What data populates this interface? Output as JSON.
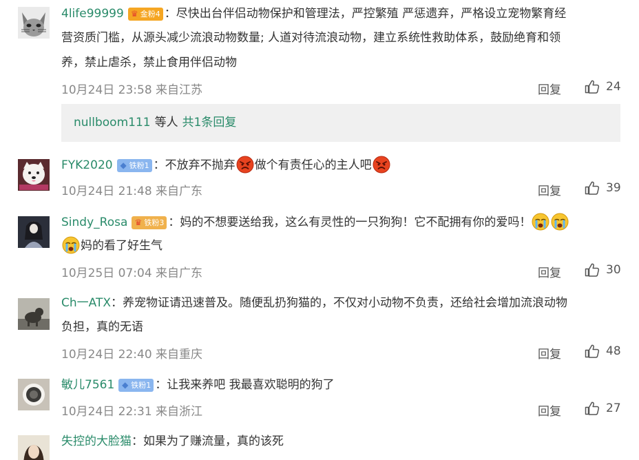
{
  "comments": [
    {
      "username": "4life99999",
      "badge": "金粉4",
      "text1": "：尽快出台伴侣动物保护和管理法，严控繁殖 严惩遗弃，严格设立宠物繁育经",
      "text2": "营资质门槛，从源头减少流浪动物数量; 人道对待流浪动物，建立系统性救助体系，鼓励绝育和领",
      "text3": "养，禁止虐杀，禁止食用伴侣动物",
      "time": "10月24日 23:58 来自江苏",
      "reply_label": "回复",
      "likes": "24"
    },
    {
      "username": "FYK2020",
      "badge": "铁粉1",
      "text_a": "：不放弃不抛弃",
      "text_b": "做个有责任心的主人吧",
      "time": "10月24日 21:48 来自广东",
      "reply_label": "回复",
      "likes": "39"
    },
    {
      "username": "Sindy_Rosa",
      "badge": "铁粉3",
      "text1": "：妈的不想要送给我，这么有灵性的一只狗狗！它不配拥有你的爱吗！",
      "text2": "妈的看了好生气",
      "time": "10月25日 07:04 来自广东",
      "reply_label": "回复",
      "likes": "30"
    },
    {
      "username": "Ch一ATX",
      "text1": "：养宠物证请迅速普及。随便乱扔狗猫的，不仅对小动物不负责，还给社会增加流浪动物",
      "text2": "负担，真的无语",
      "time": "10月24日 22:40 来自重庆",
      "reply_label": "回复",
      "likes": "48"
    },
    {
      "username": "敏儿7561",
      "badge": "铁粉1",
      "text1": "：让我来养吧 我最喜欢聪明的狗了",
      "time": "10月24日 22:31 来自浙江",
      "reply_label": "回复",
      "likes": "27"
    },
    {
      "username": "失控的大脸猫",
      "text1": "：如果为了赚流量，真的该死"
    }
  ],
  "reply_box": {
    "user": "nullboom111",
    "mid": "等人",
    "count": "共1条回复"
  },
  "emoji_names": [
    "angry-face-emoji",
    "crying-face-emoji"
  ],
  "colors": {
    "username": "#2a8b6a",
    "meta": "#888888",
    "replybox_bg": "#f0f0f0"
  }
}
